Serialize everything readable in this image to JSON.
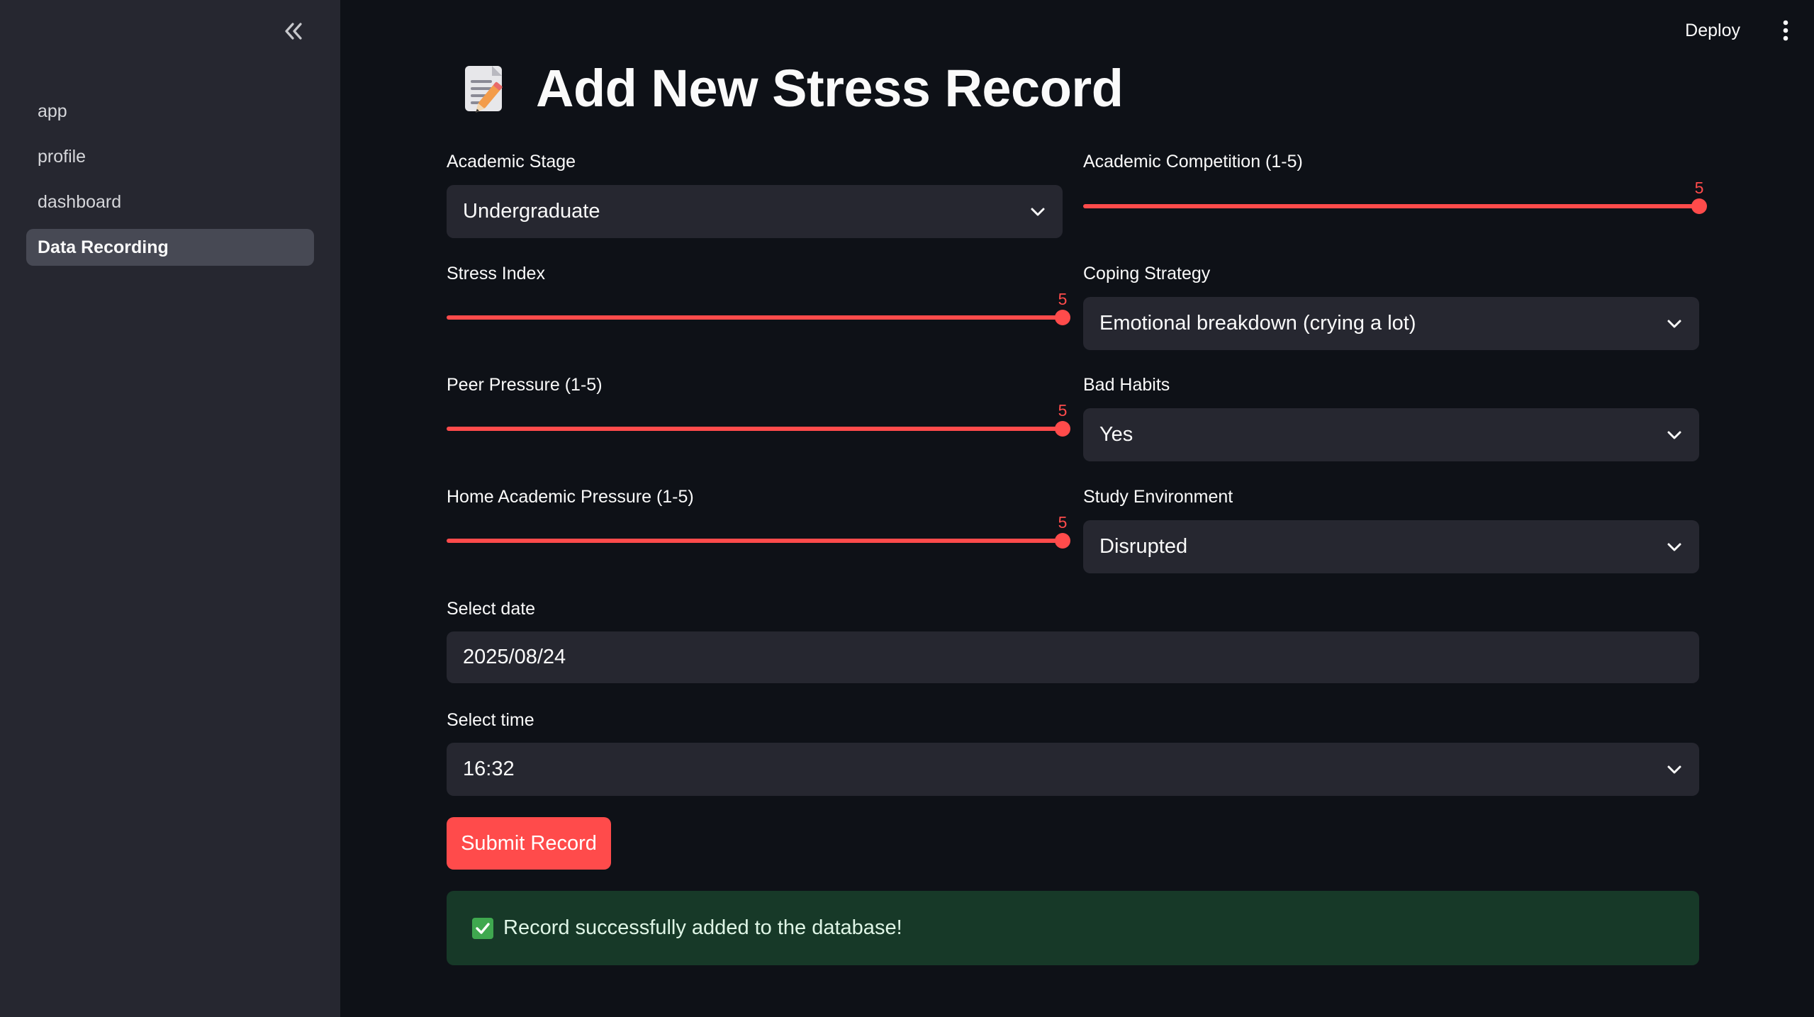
{
  "sidebar": {
    "collapse_icon": "double-chevron-left-icon",
    "items": [
      {
        "label": "app"
      },
      {
        "label": "profile"
      },
      {
        "label": "dashboard"
      },
      {
        "label": "Data Recording"
      }
    ],
    "active_index": 3
  },
  "header": {
    "deploy_label": "Deploy",
    "menu_icon": "kebab-menu-icon"
  },
  "page": {
    "title_icon": "memo-pencil-icon",
    "title": "Add New Stress Record"
  },
  "form": {
    "academic_stage": {
      "label": "Academic Stage",
      "value": "Undergraduate"
    },
    "academic_competition": {
      "label": "Academic Competition (1-5)",
      "value": "5",
      "min": 1,
      "max": 5
    },
    "stress_index": {
      "label": "Stress Index",
      "value": "5",
      "min": 1,
      "max": 5
    },
    "coping_strategy": {
      "label": "Coping Strategy",
      "value": "Emotional breakdown (crying a lot)"
    },
    "peer_pressure": {
      "label": "Peer Pressure (1-5)",
      "value": "5",
      "min": 1,
      "max": 5
    },
    "bad_habits": {
      "label": "Bad Habits",
      "value": "Yes"
    },
    "home_academic_pressure": {
      "label": "Home Academic Pressure (1-5)",
      "value": "5",
      "min": 1,
      "max": 5
    },
    "study_environment": {
      "label": "Study Environment",
      "value": "Disrupted"
    },
    "date": {
      "label": "Select date",
      "value": "2025/08/24"
    },
    "time": {
      "label": "Select time",
      "value": "16:32"
    },
    "submit_label": "Submit Record"
  },
  "alert": {
    "icon": "check-mark-icon",
    "message": "Record successfully added to the database!"
  },
  "colors": {
    "accent": "#ff4b4b",
    "background": "#0e1117",
    "sidebar": "#262730",
    "success_bg": "#173928"
  }
}
